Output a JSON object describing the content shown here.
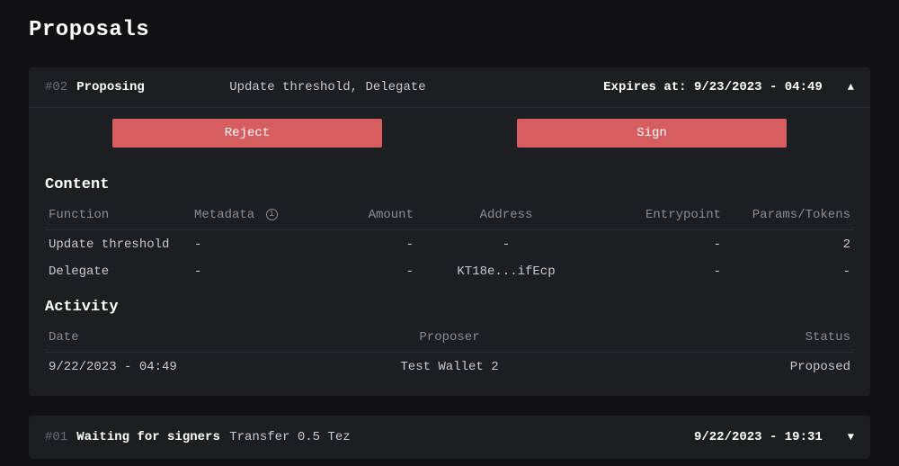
{
  "page": {
    "title": "Proposals"
  },
  "proposals": [
    {
      "id": "#02",
      "status": "Proposing",
      "summary": "Update threshold, Delegate",
      "expires_label": "Expires at:",
      "expires_value": "9/23/2023 - 04:49",
      "actions": {
        "reject": "Reject",
        "sign": "Sign"
      },
      "content": {
        "title": "Content",
        "headers": {
          "function": "Function",
          "metadata": "Metadata",
          "amount": "Amount",
          "address": "Address",
          "entrypoint": "Entrypoint",
          "params": "Params/Tokens"
        },
        "rows": [
          {
            "function": "Update threshold",
            "metadata": "-",
            "amount": "-",
            "address": "-",
            "entrypoint": "-",
            "params": "2"
          },
          {
            "function": "Delegate",
            "metadata": "-",
            "amount": "-",
            "address": "KT18e...ifEcp",
            "entrypoint": "-",
            "params": "-"
          }
        ]
      },
      "activity": {
        "title": "Activity",
        "headers": {
          "date": "Date",
          "proposer": "Proposer",
          "status": "Status"
        },
        "rows": [
          {
            "date": "9/22/2023 - 04:49",
            "proposer": "Test Wallet 2",
            "status": "Proposed"
          }
        ]
      }
    },
    {
      "id": "#01",
      "status": "Waiting for signers",
      "summary": "Transfer 0.5 Tez",
      "right_value": "9/22/2023 - 19:31"
    }
  ]
}
